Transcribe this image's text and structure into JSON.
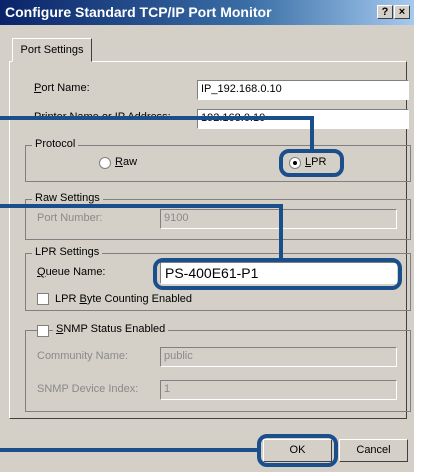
{
  "window": {
    "title": "Configure Standard TCP/IP Port Monitor",
    "help_glyph": "?",
    "close_glyph": "×"
  },
  "tabs": [
    {
      "label": "Port Settings"
    }
  ],
  "port_name": {
    "label_first": "P",
    "label_rest": "ort Name:",
    "value": "IP_192.168.0.10"
  },
  "printer_address": {
    "label": "Printer Name or IP Address:",
    "value": "192.168.0.10"
  },
  "protocol": {
    "label": "Protocol",
    "raw": {
      "label_first": "R",
      "label_rest": "aw",
      "selected": false
    },
    "lpr": {
      "label_first": "L",
      "label_rest": "PR",
      "selected": true
    }
  },
  "raw_settings": {
    "label": "Raw Settings",
    "port_number_label": "Port Number:",
    "port_number_value": "9100"
  },
  "lpr_settings": {
    "label": "LPR Settings",
    "queue_label_first": "Q",
    "queue_label_rest": "ueue Name:",
    "queue_value": "PS-400E61-P1",
    "byte_counting_label_pre": "LPR ",
    "byte_counting_label_ul": "B",
    "byte_counting_label_post": "yte Counting Enabled",
    "byte_counting_checked": false
  },
  "snmp": {
    "label_ul": "S",
    "label_rest": "NMP Status Enabled",
    "checked": false,
    "community_label": "Community Name:",
    "community_value": "public",
    "device_index_label": "SNMP Device Index:",
    "device_index_value": "1"
  },
  "buttons": {
    "ok": "OK",
    "cancel": "Cancel"
  },
  "colors": {
    "highlight": "#1a4f8c",
    "titlebar": "#0a246a",
    "dialog_face": "#d4d0c8"
  }
}
